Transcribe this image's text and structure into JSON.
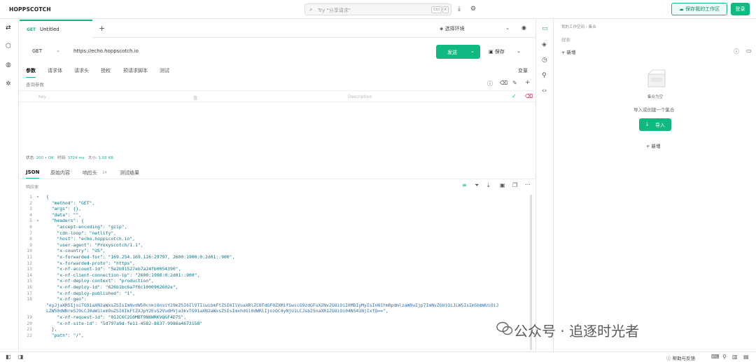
{
  "app": {
    "logo": "HOPPSCOTCH"
  },
  "search": {
    "icon": "search-icon",
    "placeholder": "Try \"分享请求\"",
    "key1": "Ctrl",
    "key2": "K"
  },
  "topbar": {
    "save_workspace": "保存我的工作区",
    "login": "登录"
  },
  "tab": {
    "method": "GET",
    "name": "Untitled",
    "add": "+"
  },
  "env": {
    "label": "选择环境"
  },
  "request": {
    "method": "GET",
    "url": "https://echo.hoppscotch.io",
    "send": "发送",
    "save": "保存"
  },
  "subtabs": [
    "参数",
    "请求体",
    "请求头",
    "授权",
    "预请求脚本",
    "测试"
  ],
  "variables_label": "变量",
  "query_label": "查询参数",
  "kv": {
    "key": "Key",
    "value": "值",
    "description": "Description"
  },
  "status": {
    "label": "状态:",
    "code": "200",
    "text": "OK",
    "time_label": "时间:",
    "time": "3724 ms",
    "size_label": "大小:",
    "size": "1.03 KB"
  },
  "response_tabs": [
    "JSON",
    "原始内容",
    "响应头",
    "测试结果"
  ],
  "response_headers_count": "14",
  "response_label": "响应体",
  "code_lines": [
    {
      "n": "1",
      "f": "▾",
      "t": "{"
    },
    {
      "n": "2",
      "f": "",
      "t": "  \"method\": \"GET\","
    },
    {
      "n": "3",
      "f": "",
      "t": "  \"args\": {},"
    },
    {
      "n": "4",
      "f": "",
      "t": "  \"data\": \"\","
    },
    {
      "n": "5",
      "f": "▾",
      "t": "  \"headers\": {"
    },
    {
      "n": "6",
      "f": "",
      "t": "    \"accept-encoding\": \"gzip\","
    },
    {
      "n": "7",
      "f": "",
      "t": "    \"cdn-loop\": \"netlify\","
    },
    {
      "n": "8",
      "f": "",
      "t": "    \"host\": \"echo.hoppscotch.io\","
    },
    {
      "n": "9",
      "f": "",
      "t": "    \"user-agent\": \"Proxyscotch/1.1\","
    },
    {
      "n": "10",
      "f": "",
      "t": "    \"x-country\": \"US\","
    },
    {
      "n": "11",
      "f": "",
      "t": "    \"x-forwarded-for\": \"169.254.169.126:29797, 2600:1900:0:2d01::900\","
    },
    {
      "n": "12",
      "f": "",
      "t": "    \"x-forwarded-proto\": \"https\","
    },
    {
      "n": "13",
      "f": "",
      "t": "    \"x-nf-account-id\": \"5e2b91527eb7a24fb0054390\","
    },
    {
      "n": "14",
      "f": "",
      "t": "    \"x-nf-client-connection-ip\": \"2600:1900:0:2d01::900\","
    },
    {
      "n": "15",
      "f": "",
      "t": "    \"x-nf-deploy-context\": \"production\","
    },
    {
      "n": "16",
      "f": "",
      "t": "    \"x-nf-deploy-id\": \"626b1bc6a7f6c1000902602e\","
    },
    {
      "n": "17",
      "f": "",
      "t": "    \"x-nf-deploy-published\": \"1\","
    },
    {
      "n": "18",
      "f": "",
      "t": "    \"x-nf-geo\":"
    }
  ],
  "geo_wrap1": "\"eyJjaXR5IjoiTG91aXN2aWxsZSIsImNvdW50cnkiOnsiY29kZSI6IlVTIiwibmFtZSI6IlVuaXRlZCBTdGF0ZXMifSwicG9zdGFsX2NvZGUiOiI0MDIyMyIsInN1YmRpdmlzaW9uIjp7ImNvZGUiOiJLWSIsIm5hbWUiOiJ",
  "geo_wrap2": "LZW50dWNreSJ9LCJ0aW1lem9uZSI6IkFtZXJpY2EvS2VudHVja3kvTG91aXN2aWxsZSIsImxhdGl0dWRlIjozOC4yNjU1LCJsb25naXR1ZGUiOi04NS41NjIxfQ==\",",
  "code_lines_tail": [
    {
      "n": "19",
      "f": "",
      "t": "    \"x-nf-request-id\": \"01JC6C2G0MBT9N6WRKVQGF4D7S\","
    },
    {
      "n": "20",
      "f": "",
      "t": "    \"x-nf-site-id\": \"5d797a9d-fe11-4582-8837-9986a4673158\""
    },
    {
      "n": "21",
      "f": "",
      "t": "  },"
    },
    {
      "n": "22",
      "f": "",
      "t": "  \"path\": \"/\","
    }
  ],
  "right_panel": {
    "breadcrumb": "我的工作空间  ›  集合",
    "search": "搜索",
    "new": "新增",
    "empty_title": "集合为空",
    "empty_sub": "导入或创建一个集合",
    "import": "导入",
    "new2": "新增"
  },
  "footer": {
    "help": "帮助与反馈"
  },
  "watermark": "公众号 · 追逐时光者",
  "colors": {
    "accent": "#10b981"
  }
}
